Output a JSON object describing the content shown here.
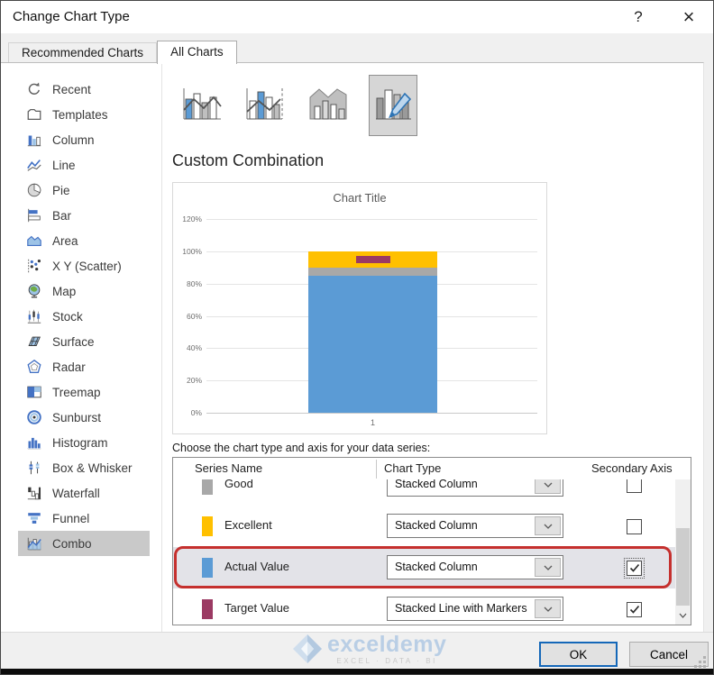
{
  "window": {
    "title": "Change Chart Type",
    "help_label": "?",
    "close_label": "×"
  },
  "tabs": [
    {
      "label": "Recommended Charts",
      "active": false
    },
    {
      "label": "All Charts",
      "active": true
    }
  ],
  "sidebar": {
    "items": [
      {
        "label": "Recent",
        "icon": "recent-icon"
      },
      {
        "label": "Templates",
        "icon": "templates-icon"
      },
      {
        "label": "Column",
        "icon": "column-icon"
      },
      {
        "label": "Line",
        "icon": "line-icon"
      },
      {
        "label": "Pie",
        "icon": "pie-icon"
      },
      {
        "label": "Bar",
        "icon": "bar-icon"
      },
      {
        "label": "Area",
        "icon": "area-icon"
      },
      {
        "label": "X Y (Scatter)",
        "icon": "scatter-icon"
      },
      {
        "label": "Map",
        "icon": "map-icon"
      },
      {
        "label": "Stock",
        "icon": "stock-icon"
      },
      {
        "label": "Surface",
        "icon": "surface-icon"
      },
      {
        "label": "Radar",
        "icon": "radar-icon"
      },
      {
        "label": "Treemap",
        "icon": "treemap-icon"
      },
      {
        "label": "Sunburst",
        "icon": "sunburst-icon"
      },
      {
        "label": "Histogram",
        "icon": "histogram-icon"
      },
      {
        "label": "Box & Whisker",
        "icon": "box-whisker-icon"
      },
      {
        "label": "Waterfall",
        "icon": "waterfall-icon"
      },
      {
        "label": "Funnel",
        "icon": "funnel-icon"
      },
      {
        "label": "Combo",
        "icon": "combo-icon",
        "selected": true
      }
    ]
  },
  "subtypes": {
    "items": [
      {
        "name": "clustered-column-line",
        "selected": false
      },
      {
        "name": "clustered-column-line-secondary-axis",
        "selected": false
      },
      {
        "name": "stacked-area-clustered-column",
        "selected": false
      },
      {
        "name": "custom-combination",
        "selected": true
      }
    ]
  },
  "section": {
    "heading": "Custom Combination"
  },
  "chart_data": {
    "type": "combo",
    "title": "Chart Title",
    "categories": [
      "1"
    ],
    "series": [
      {
        "name": "Actual Value",
        "chart_type": "stacked-column",
        "color": "#5b9bd5",
        "values": [
          85
        ]
      },
      {
        "name": "Good",
        "chart_type": "stacked-column",
        "color": "#a8a8a8",
        "values": [
          5
        ]
      },
      {
        "name": "Excellent",
        "chart_type": "stacked-column",
        "color": "#ffc000",
        "values": [
          10
        ]
      },
      {
        "name": "Target Value",
        "chart_type": "stacked-line-with-markers",
        "color": "#9b3a63",
        "values": [
          95
        ]
      }
    ],
    "ylim": [
      0,
      120
    ],
    "yticks": [
      0,
      20,
      40,
      60,
      80,
      100,
      120
    ],
    "ytick_suffix": "%",
    "grid": true,
    "legend": "none"
  },
  "series_table": {
    "instruction": "Choose the chart type and axis for your data series:",
    "columns": [
      "Series Name",
      "Chart Type",
      "Secondary Axis"
    ],
    "rows": [
      {
        "name": "Good",
        "swatch": "#a8a8a8",
        "chart_type": "Stacked Column",
        "secondary_axis": false,
        "highlighted": false
      },
      {
        "name": "Excellent",
        "swatch": "#ffc000",
        "chart_type": "Stacked Column",
        "secondary_axis": false,
        "highlighted": false
      },
      {
        "name": "Actual Value",
        "swatch": "#5b9bd5",
        "chart_type": "Stacked Column",
        "secondary_axis": true,
        "highlighted": true
      },
      {
        "name": "Target Value",
        "swatch": "#9b3a63",
        "chart_type": "Stacked Line with Markers",
        "secondary_axis": true,
        "highlighted": false
      }
    ]
  },
  "watermark": {
    "brand": "exceldemy",
    "tagline": "EXCEL · DATA · BI"
  },
  "footer": {
    "ok_label": "OK",
    "cancel_label": "Cancel"
  },
  "colors": {
    "accent_blue": "#5b9bd5",
    "accent_yellow": "#ffc000",
    "accent_gray": "#a8a8a8",
    "accent_magenta": "#9b3a63",
    "annotation_red": "#c5302e",
    "selected_row_bg": "#e3e3e8",
    "sidebar_selected_bg": "#c9c9c9",
    "ok_border_blue": "#1467b8"
  }
}
